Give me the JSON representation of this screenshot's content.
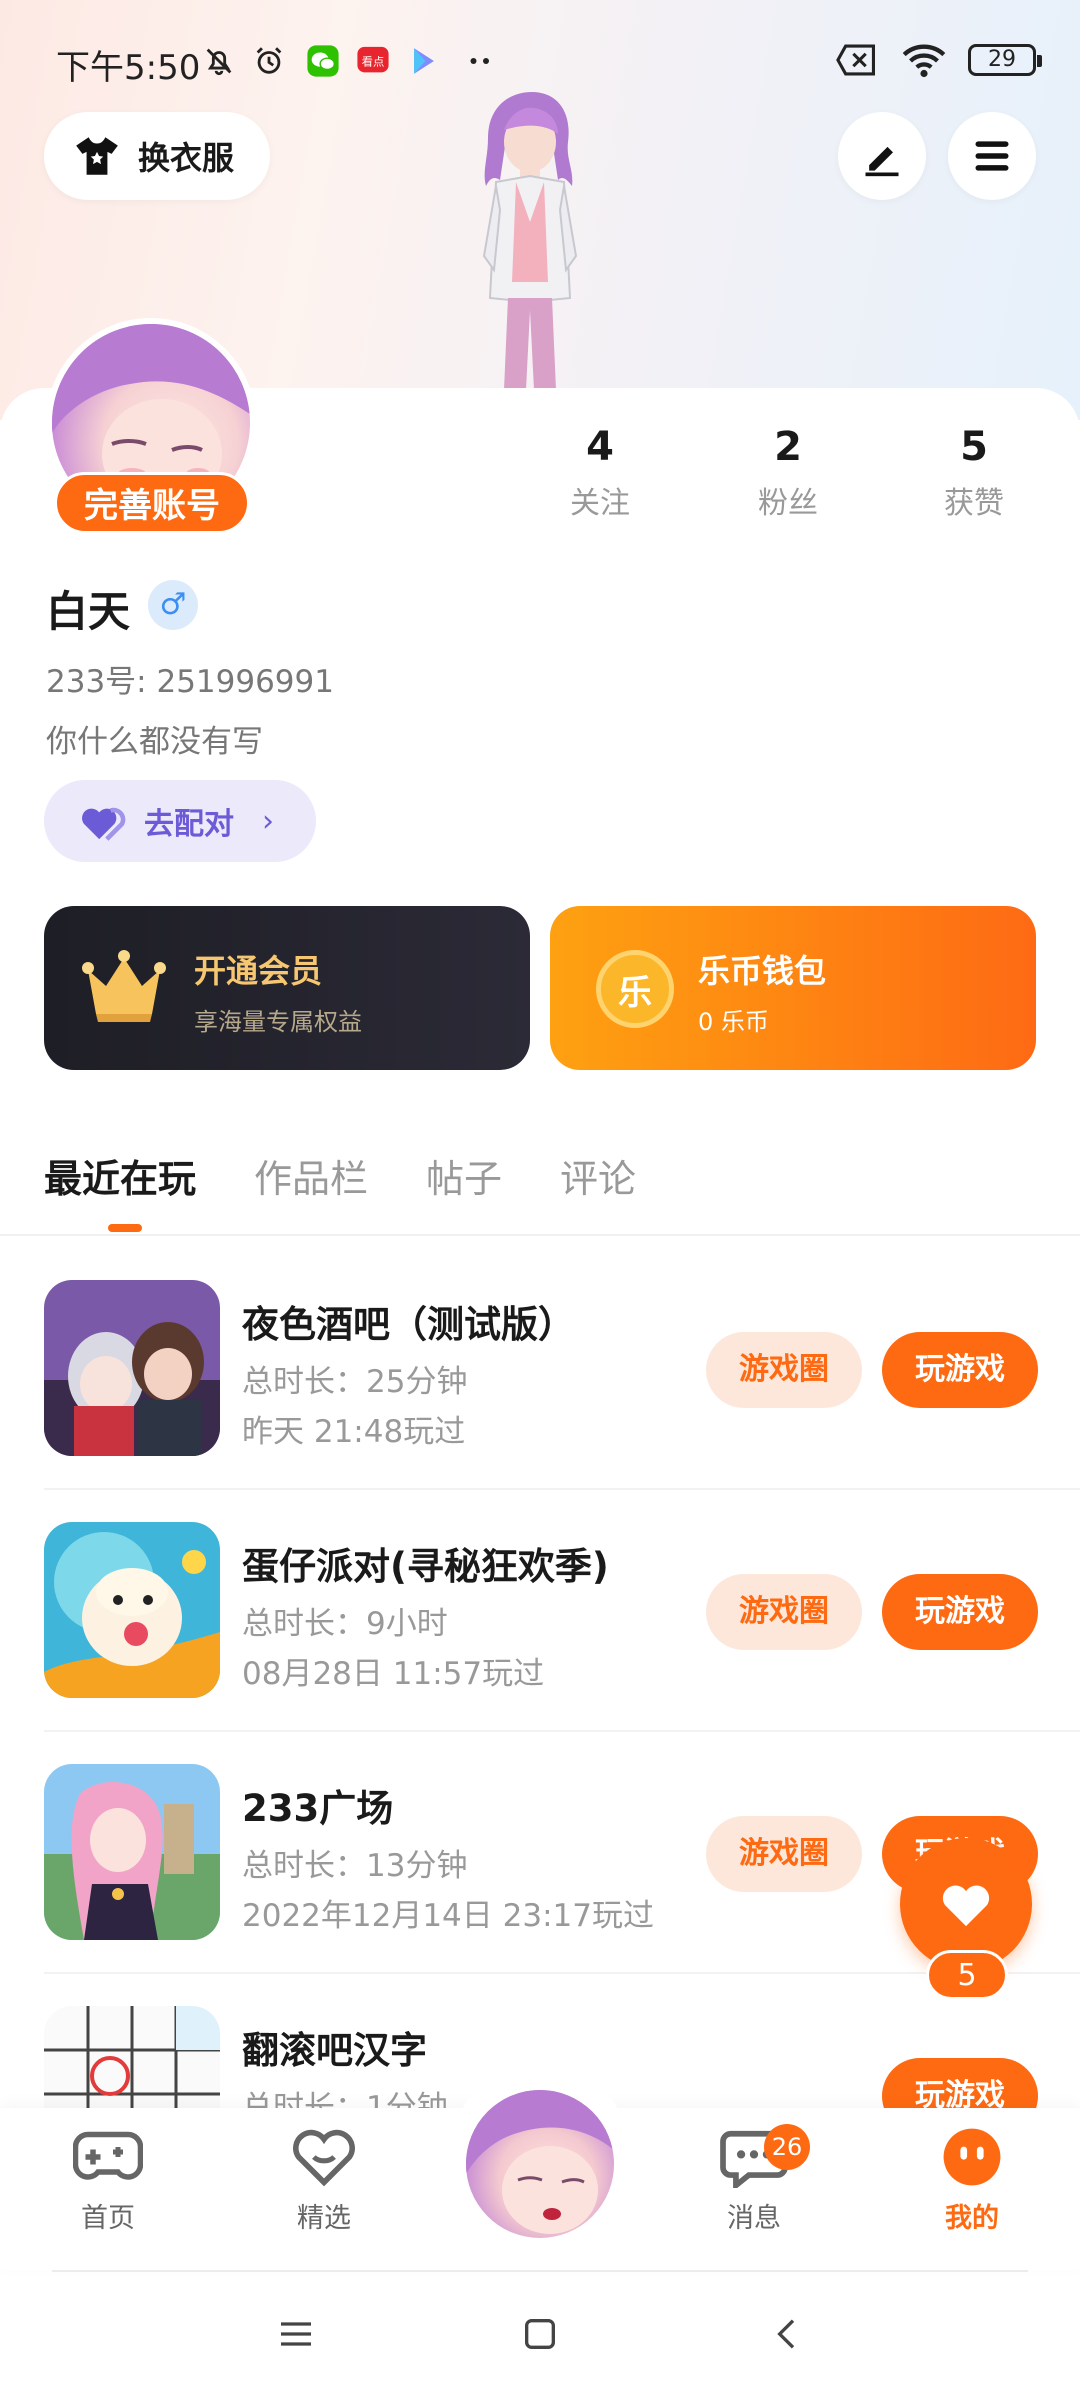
{
  "status_bar": {
    "time": "下午5:50",
    "battery": "29",
    "icons": [
      "mute-icon",
      "alarm-icon",
      "wechat-icon",
      "kandian-icon",
      "play-store-icon",
      "more-dots-icon",
      "sim-icon",
      "wifi-icon",
      "battery-icon"
    ]
  },
  "header": {
    "outfit_label": "换衣服",
    "edit_icon": "pen-icon",
    "menu_icon": "menu-icon"
  },
  "profile": {
    "complete_badge": "完善账号",
    "username": "白天",
    "gender_symbol": "♂",
    "uid": "233号: 251996991",
    "bio": "你什么都没有写",
    "match_label": "去配对",
    "stats": [
      {
        "num": "4",
        "label": "关注"
      },
      {
        "num": "2",
        "label": "粉丝"
      },
      {
        "num": "5",
        "label": "获赞"
      }
    ]
  },
  "promos": {
    "vip": {
      "title": "开通会员",
      "subtitle": "享海量专属权益"
    },
    "wallet": {
      "title": "乐币钱包",
      "subtitle": "0 乐币",
      "coin_char": "乐"
    }
  },
  "tabs": [
    "最近在玩",
    "作品栏",
    "帖子",
    "评论"
  ],
  "games": [
    {
      "name": "夜色酒吧（测试版）",
      "duration": "总时长：25分钟",
      "last_played": "昨天 21:48玩过",
      "circle_label": "游戏圈",
      "play_label": "玩游戏"
    },
    {
      "name": "蛋仔派对(寻秘狂欢季)",
      "duration": "总时长：9小时",
      "last_played": "08月28日 11:57玩过",
      "circle_label": "游戏圈",
      "play_label": "玩游戏"
    },
    {
      "name": "233广场",
      "duration": "总时长：13分钟",
      "last_played": "2022年12月14日 23:17玩过",
      "circle_label": "游戏圈",
      "play_label": "玩游戏"
    },
    {
      "name": "翻滚吧汉字",
      "duration": "总时长：1分钟",
      "last_played": "",
      "circle_label": "",
      "play_label": "玩游戏"
    }
  ],
  "fab": {
    "count": "5"
  },
  "bottom_nav": {
    "items": [
      {
        "label": "首页"
      },
      {
        "label": "精选"
      },
      {
        "label": "消息",
        "badge": "26"
      },
      {
        "label": "我的"
      }
    ]
  },
  "colors": {
    "accent": "#fe6a12",
    "vip_bg": "#1e1e26",
    "match_purple": "#6b5bd6"
  }
}
